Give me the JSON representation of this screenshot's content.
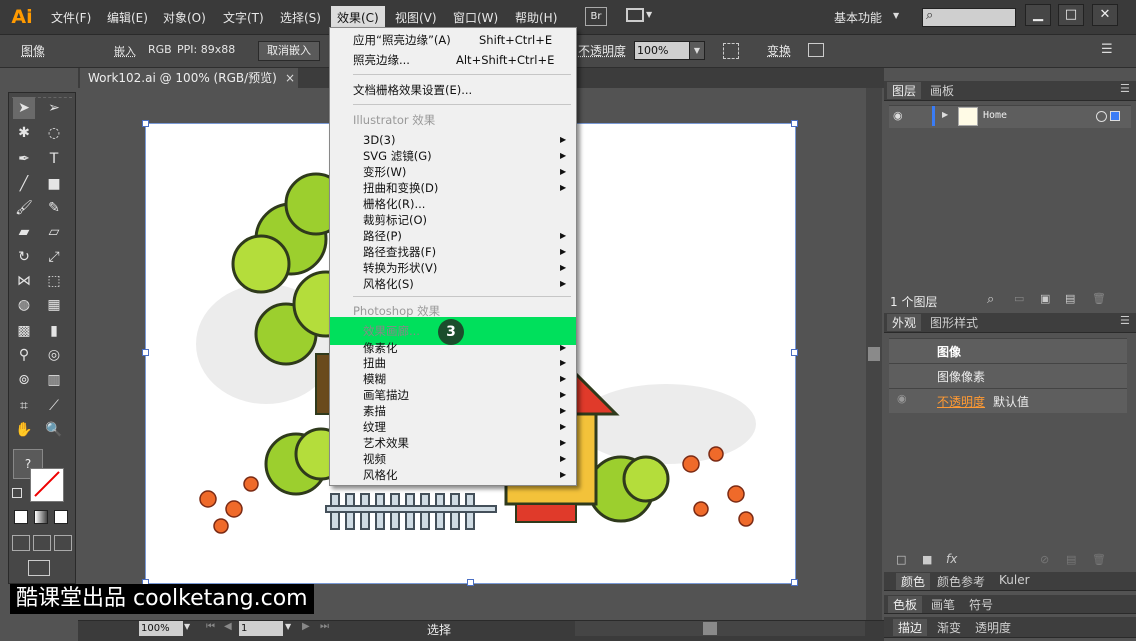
{
  "app": {
    "logo": "Ai",
    "menus": [
      "文件(F)",
      "编辑(E)",
      "对象(O)",
      "文字(T)",
      "选择(S)",
      "效果(C)",
      "视图(V)",
      "窗口(W)",
      "帮助(H)"
    ],
    "br_label": "Br",
    "workspace": "基本功能",
    "win_min": "▁",
    "win_max": "□",
    "win_close": "✕"
  },
  "control_bar": {
    "object_type": "图像",
    "embed_label": "嵌入",
    "color_mode": "RGB",
    "ppi": "PPI: 89x88",
    "unembed_button": "取消嵌入",
    "opacity_label": "不透明度",
    "opacity_value": "100%",
    "transform_label": "变换"
  },
  "document": {
    "tab_title": "Work102.ai @ 100% (RGB/预览)",
    "tab_close": "×"
  },
  "effects_menu": {
    "items": [
      {
        "label": "应用“照亮边缘”(A)",
        "shortcut": "Shift+Ctrl+E"
      },
      {
        "label": "照亮边缘...",
        "shortcut": "Alt+Shift+Ctrl+E"
      },
      {
        "label": "文档栅格效果设置(E)..."
      },
      {
        "label": "Illustrator 效果"
      },
      {
        "label": "3D(3)"
      },
      {
        "label": "SVG 滤镜(G)"
      },
      {
        "label": "变形(W)"
      },
      {
        "label": "扭曲和变换(D)"
      },
      {
        "label": "栅格化(R)..."
      },
      {
        "label": "裁剪标记(O)"
      },
      {
        "label": "路径(P)"
      },
      {
        "label": "路径查找器(F)"
      },
      {
        "label": "转换为形状(V)"
      },
      {
        "label": "风格化(S)"
      },
      {
        "label": "Photoshop 效果"
      },
      {
        "label": "效果画廊..."
      },
      {
        "label": "像素化"
      },
      {
        "label": "扭曲"
      },
      {
        "label": "模糊"
      },
      {
        "label": "画笔描边"
      },
      {
        "label": "素描"
      },
      {
        "label": "纹理"
      },
      {
        "label": "艺术效果"
      },
      {
        "label": "视频"
      },
      {
        "label": "风格化"
      }
    ],
    "step_badge": "3",
    "highlight_color": "#00e05c"
  },
  "layers_panel": {
    "tabs": [
      "图层",
      "画板"
    ],
    "layer_name": "Home",
    "footer": "1 个图层"
  },
  "appearance_panel": {
    "tabs": [
      "外观",
      "图形样式"
    ],
    "title": "图像",
    "pixel_row": "图像像素",
    "opacity_label": "不透明度",
    "opacity_value": "默认值"
  },
  "bottom_panels": {
    "row1": [
      "颜色",
      "颜色参考",
      "Kuler"
    ],
    "row2": [
      "色板",
      "画笔",
      "符号"
    ],
    "row3": [
      "描边",
      "渐变",
      "透明度"
    ]
  },
  "status_bar": {
    "zoom": "100%",
    "page": "1",
    "tool": "选择"
  },
  "toolbox": {
    "fill_question": "?"
  },
  "watermark": "酷课堂出品 coolketang.com"
}
